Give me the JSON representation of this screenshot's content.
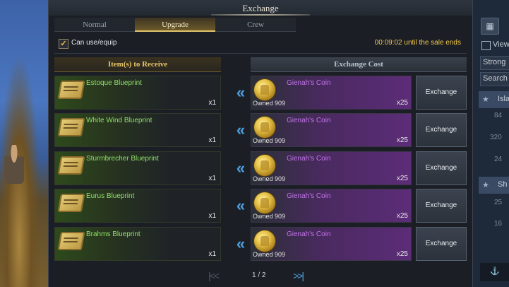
{
  "window": {
    "title": "Exchange"
  },
  "tabs": [
    {
      "label": "Normal",
      "active": false
    },
    {
      "label": "Upgrade",
      "active": true
    },
    {
      "label": "Crew",
      "active": false
    }
  ],
  "filter": {
    "label": "Can use/equip",
    "checked": true,
    "timer": "00:09:02 until the sale ends"
  },
  "columns": {
    "receive": "Item(s) to Receive",
    "cost": "Exchange Cost"
  },
  "rows": [
    {
      "item": "Estoque Blueprint",
      "item_qty": "x1",
      "coin": "Gienah's Coin",
      "owned": "Owned 909",
      "cost_qty": "x25",
      "button": "Exchange"
    },
    {
      "item": "White Wind Blueprint",
      "item_qty": "x1",
      "coin": "Gienah's Coin",
      "owned": "Owned 909",
      "cost_qty": "x25",
      "button": "Exchange"
    },
    {
      "item": "Sturmbrecher Blueprint",
      "item_qty": "x1",
      "coin": "Gienah's Coin",
      "owned": "Owned 909",
      "cost_qty": "x25",
      "button": "Exchange"
    },
    {
      "item": "Eurus Blueprint",
      "item_qty": "x1",
      "coin": "Gienah's Coin",
      "owned": "Owned 909",
      "cost_qty": "x25",
      "button": "Exchange"
    },
    {
      "item": "Brahms Blueprint",
      "item_qty": "x1",
      "coin": "Gienah's Coin",
      "owned": "Owned 909",
      "cost_qty": "x25",
      "button": "Exchange"
    }
  ],
  "pagination": {
    "text": "1 / 2",
    "prev_icon": "double-chevron-left",
    "next_icon": "double-chevron-right"
  },
  "side_panel": {
    "view": "View",
    "strong": "Strong",
    "search": "Search",
    "island": "Isla",
    "ship": "Sh",
    "numbers": [
      "84",
      "320",
      "24",
      "25",
      "16"
    ]
  },
  "colors": {
    "accent_gold": "#e6c46a",
    "item_green": "#8fe06a",
    "coin_purple": "#c574ec",
    "arrow_blue": "#4f9ee0",
    "timer": "#f3c64a"
  }
}
